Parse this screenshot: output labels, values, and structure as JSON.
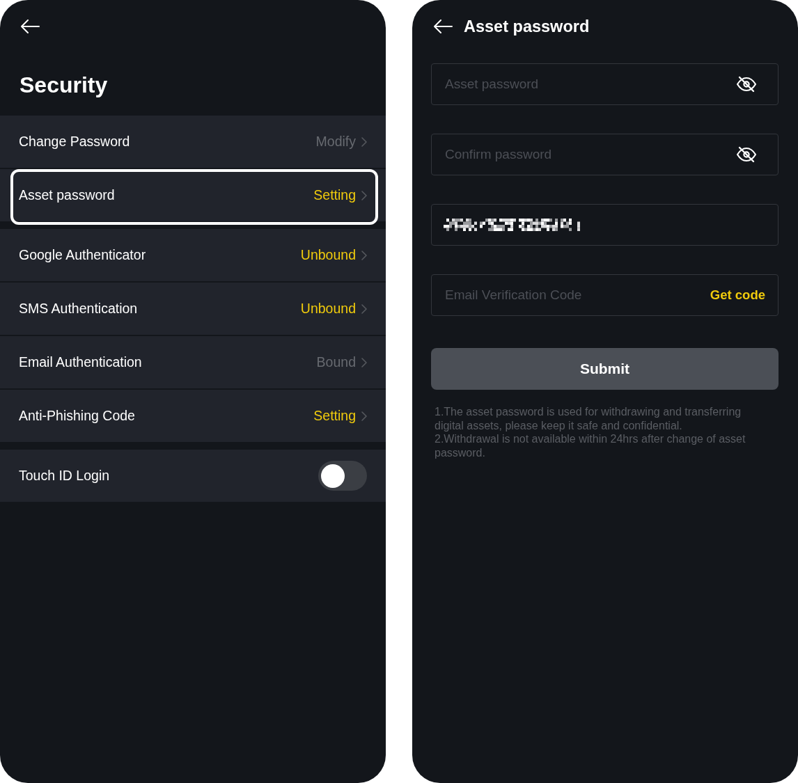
{
  "security_screen": {
    "title": "Security",
    "groups": [
      {
        "items": [
          {
            "kind": "link",
            "label": "Change Password",
            "value": "Modify",
            "color": "#676a70",
            "highlighted": false
          },
          {
            "kind": "link",
            "label": "Asset password",
            "value": "Setting",
            "color": "#f0cb0c",
            "highlighted": true
          }
        ]
      },
      {
        "items": [
          {
            "kind": "link",
            "label": "Google Authenticator",
            "value": "Unbound",
            "color": "#f0cb0c",
            "highlighted": false
          },
          {
            "kind": "link",
            "label": "SMS Authentication",
            "value": "Unbound",
            "color": "#f0cb0c",
            "highlighted": false
          },
          {
            "kind": "link",
            "label": "Email Authentication",
            "value": "Bound",
            "color": "#676a70",
            "highlighted": false
          },
          {
            "kind": "link",
            "label": "Anti-Phishing Code",
            "value": "Setting",
            "color": "#f0cb0c",
            "highlighted": false
          }
        ]
      },
      {
        "items": [
          {
            "kind": "toggle",
            "label": "Touch ID Login",
            "on": false
          }
        ]
      }
    ]
  },
  "asset_password_screen": {
    "title": "Asset password",
    "fields": [
      {
        "kind": "password",
        "placeholder": "Asset password",
        "masked": true
      },
      {
        "kind": "password",
        "placeholder": "Confirm password",
        "masked": true
      },
      {
        "kind": "redacted"
      },
      {
        "kind": "code",
        "placeholder": "Email Verification Code",
        "action": "Get code"
      }
    ],
    "submit": {
      "label": "Submit",
      "disabled": true
    },
    "notes": [
      "1.The asset password is used for withdrawing and transferring digital assets, please keep it safe and confidential.",
      "2.Withdrawal is not available within 24hrs after change of asset password."
    ]
  }
}
